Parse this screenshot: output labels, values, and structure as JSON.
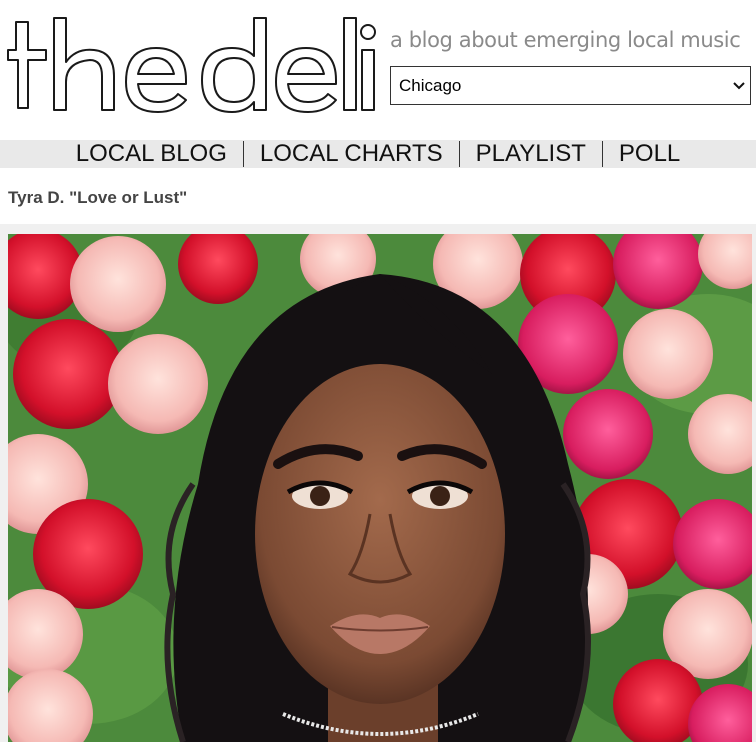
{
  "site": {
    "logo_text": "the deli",
    "tagline": "a blog about emerging local music"
  },
  "city_select": {
    "selected": "Chicago"
  },
  "nav": {
    "items": [
      {
        "label": "LOCAL BLOG"
      },
      {
        "label": "LOCAL CHARTS"
      },
      {
        "label": "PLAYLIST"
      },
      {
        "label": "POLL"
      }
    ]
  },
  "post": {
    "title": "Tyra D. \"Love or Lust\""
  },
  "colors": {
    "nav_bg": "#e9e9e9",
    "tagline": "#8a8a8a",
    "title": "#444444"
  },
  "icons": [
    "chevron-down-icon"
  ]
}
